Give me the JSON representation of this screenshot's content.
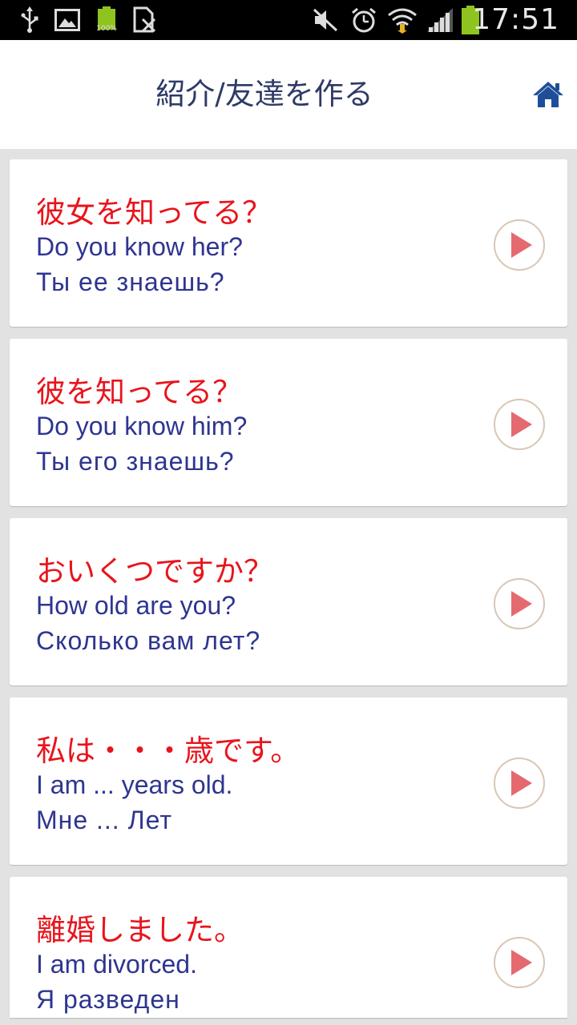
{
  "status_bar": {
    "time": "17:51",
    "battery_small_label": "100%",
    "icons": [
      "usb-icon",
      "image-icon",
      "battery-small-icon",
      "no-sim-icon",
      "mute-icon",
      "alarm-icon",
      "wifi-icon",
      "signal-icon",
      "battery-icon"
    ]
  },
  "header": {
    "title": "紹介/友達を作る",
    "home_icon": "home-icon"
  },
  "colors": {
    "japanese_text": "#e8141c",
    "translation_text": "#2e3590",
    "header_text": "#2e3a66",
    "play_triangle": "#e46a6f",
    "background": "#e2e2e2"
  },
  "phrases": [
    {
      "ja": "彼女を知ってる？",
      "en": "Do you know her?",
      "ru": "Ты ее знаешь?"
    },
    {
      "ja": "彼を知ってる？",
      "en": "Do you know him?",
      "ru": "Ты его знаешь?"
    },
    {
      "ja": "おいくつですか？",
      "en": "How old are you?",
      "ru": "Сколько вам лет?"
    },
    {
      "ja": "私は・・・歳です。",
      "en": "I am ... years old.",
      "ru": "Мне ... Лет"
    },
    {
      "ja": "離婚しました。",
      "en": "I am divorced.",
      "ru": "Я разведен"
    }
  ]
}
